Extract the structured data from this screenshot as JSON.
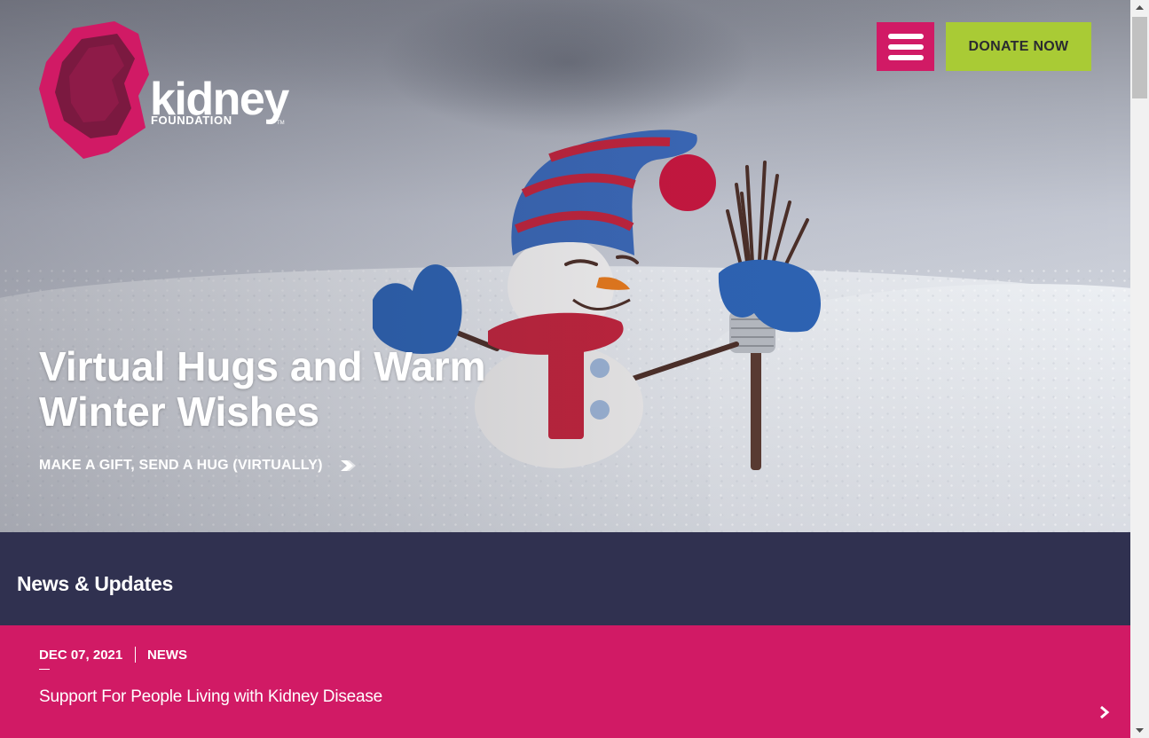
{
  "logo": {
    "word": "kidney",
    "sub": "FOUNDATION",
    "tm": "TM"
  },
  "header": {
    "donate_label": "DONATE NOW"
  },
  "hero": {
    "title": "Virtual Hugs and Warm Winter Wishes",
    "link_label": "MAKE A GIFT, SEND A HUG (VIRTUALLY)"
  },
  "news": {
    "section_title": "News & Updates",
    "items": [
      {
        "date": "DEC 07, 2021",
        "category": "NEWS",
        "headline": "Support For People Living with Kidney Disease"
      }
    ]
  },
  "colors": {
    "brand_pink": "#d11a65",
    "brand_dark": "#303150",
    "donate_green": "#a9cb35"
  },
  "icons": {
    "menu": "hamburger-menu-icon",
    "link_arrow": "double-chevron-right-icon",
    "news_arrow": "chevron-right-icon"
  }
}
